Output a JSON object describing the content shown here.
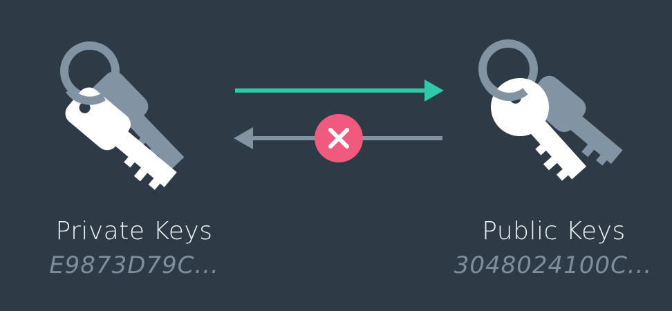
{
  "private": {
    "label": "Private Keys",
    "hash": "E9873D79C..."
  },
  "public": {
    "label": "Public Keys",
    "hash": "3048024100C..."
  },
  "colors": {
    "background": "#2e3a45",
    "key_front": "#ffffff",
    "key_back": "#8294a4",
    "ring": "#8294a4",
    "forward_arrow": "#2ec8aa",
    "reverse_arrow": "#8294a4",
    "blocked_badge": "#f05a7e"
  },
  "icons": {
    "private_keys": "key-pair-icon",
    "public_keys": "key-pair-icon",
    "blocked": "x-circle-icon"
  }
}
